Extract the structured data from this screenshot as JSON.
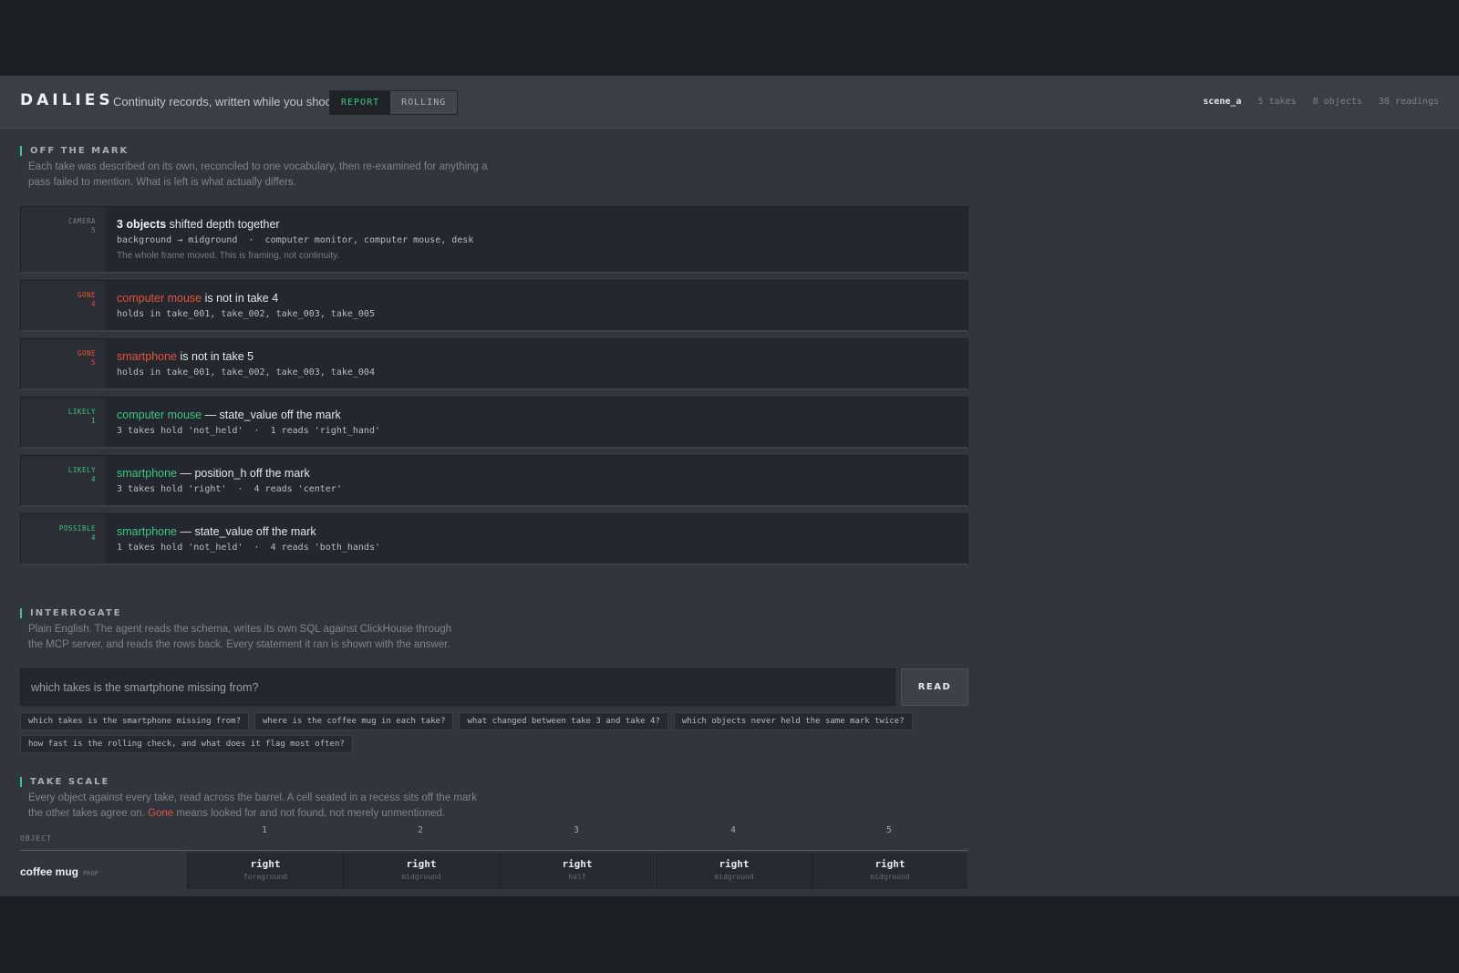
{
  "header": {
    "brand": "DAILIES",
    "tagline": "Continuity records, written while you shoot.",
    "modes": [
      "REPORT",
      "ROLLING"
    ],
    "stats": {
      "scene": "scene_a",
      "takes": "5 takes",
      "objects": "8 objects",
      "readings": "38 readings"
    }
  },
  "off_mark": {
    "title": "OFF THE MARK",
    "desc": "Each take was described on its own, reconciled to one vocabulary, then re-examined for anything a pass failed to mention. What is left is what actually differs.",
    "cards": [
      {
        "tag": "CAMERA",
        "num": "5",
        "kind": "camera",
        "head_pre": "3 objects",
        "head_post": " shifted depth together",
        "mono": "background → midground  ·  computer monitor, computer mouse, desk",
        "note": "The whole frame moved. This is framing, not continuity."
      },
      {
        "tag": "GONE",
        "num": "4",
        "kind": "gone",
        "object": "computer mouse",
        "head_post": " is not in take 4",
        "mono": "holds in take_001, take_002, take_003, take_005"
      },
      {
        "tag": "GONE",
        "num": "5",
        "kind": "gone",
        "object": "smartphone",
        "head_post": " is not in take 5",
        "mono": "holds in take_001, take_002, take_003, take_004"
      },
      {
        "tag": "LIKELY",
        "num": "1",
        "kind": "likely",
        "object": "computer mouse",
        "head_post": " — state_value off the mark",
        "mono": "3 takes hold 'not_held'  ·  1 reads 'right_hand'"
      },
      {
        "tag": "LIKELY",
        "num": "4",
        "kind": "likely",
        "object": "smartphone",
        "head_post": " — position_h off the mark",
        "mono": "3 takes hold 'right'  ·  4 reads 'center'"
      },
      {
        "tag": "POSSIBLE",
        "num": "4",
        "kind": "possible",
        "object": "smartphone",
        "head_post": " — state_value off the mark",
        "mono": "1 takes hold 'not_held'  ·  4 reads 'both_hands'"
      }
    ]
  },
  "interrogate": {
    "title": "INTERROGATE",
    "desc": "Plain English. The agent reads the schema, writes its own SQL against ClickHouse through the MCP server, and reads the rows back. Every statement it ran is shown with the answer.",
    "query_value": "which takes is the smartphone missing from?",
    "read_label": "READ",
    "suggestions": [
      "which takes is the smartphone missing from?",
      "where is the coffee mug in each take?",
      "what changed between take 3 and take 4?",
      "which objects never held the same mark twice?",
      "how fast is the rolling check, and what does it flag most often?"
    ]
  },
  "take_scale": {
    "title": "TAKE SCALE",
    "desc_pre": "Every object against every take, read across the barrel. A cell seated in a recess sits off the mark the other takes agree on. ",
    "desc_gone": "Gone",
    "desc_post": " means looked for and not found, not merely unmentioned.",
    "object_label": "OBJECT",
    "takes": [
      "1",
      "2",
      "3",
      "4",
      "5"
    ],
    "rows": [
      {
        "name": "coffee mug",
        "kind": "PROP",
        "cells": [
          {
            "val": "right",
            "sub": "foreground"
          },
          {
            "val": "right",
            "sub": "midground"
          },
          {
            "val": "right",
            "sub": "half"
          },
          {
            "val": "right",
            "sub": "midground"
          },
          {
            "val": "right",
            "sub": "midground"
          }
        ]
      }
    ]
  },
  "colors": {
    "accent": "#3fc587",
    "gone": "#e2553a",
    "background": "#31353d",
    "card": "#24272d"
  }
}
